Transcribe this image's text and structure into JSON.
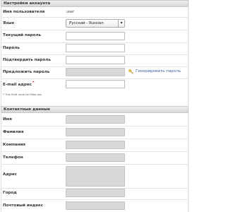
{
  "account": {
    "header": "Настройки аккаунта",
    "username_label": "Имя пользователя",
    "username_value": "user",
    "language_label": "Язык",
    "language_selected": "Русский - Russian",
    "current_password_label": "Текущий пароль",
    "password_label": "Пароль",
    "confirm_password_label": "Подтвердить пароль",
    "suggest_password_label": "Предложить пароль",
    "generate_password_link": "Генерировать пароль",
    "email_label": "E-mail адрес",
    "required_mark": "*",
    "required_note": "* This field must be filled out"
  },
  "contact": {
    "header": "Контактные данные",
    "first_name_label": "Имя",
    "last_name_label": "Фамилия",
    "company_label": "Компания",
    "phone_label": "Телефон",
    "address_label": "Адрес",
    "city_label": "Город",
    "postal_code_label": "Почтовый индекс"
  },
  "icons": {
    "select_arrow": "chevron-down-icon",
    "generate_password": "key-icon"
  },
  "colors": {
    "header_bg": "#e2e2e2",
    "filled_input_bg": "#d8d8d8",
    "link": "#3a5fa0",
    "key_icon": "#e2b318",
    "required": "#cc0000"
  }
}
